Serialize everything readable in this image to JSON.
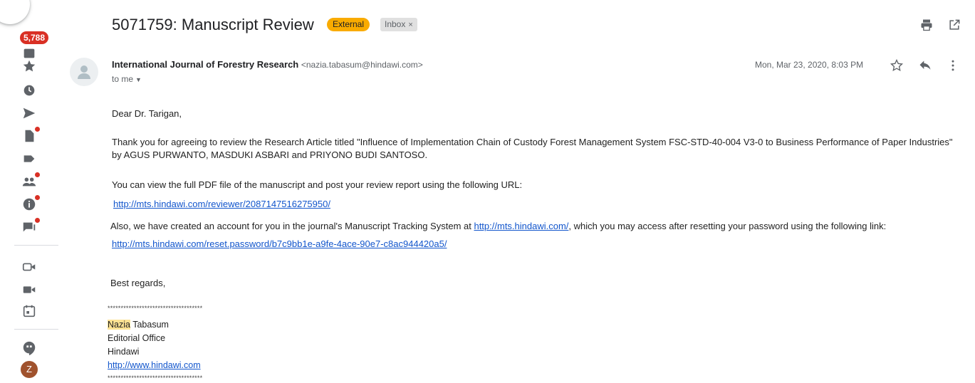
{
  "rail": {
    "unread_count": "5,788",
    "avatar_letter": "Z"
  },
  "email": {
    "subject": "5071759: Manuscript Review",
    "label_external": "External",
    "label_inbox": "Inbox",
    "label_inbox_close": "×",
    "sender_name": "International Journal of Forestry Research",
    "sender_email": "<nazia.tabasum@hindawi.com>",
    "to": "to me",
    "date": "Mon, Mar 23, 2020, 8:03 PM"
  },
  "body": {
    "greeting": "Dear Dr. Tarigan,",
    "para1": "Thank you for agreeing to review the Research Article titled \"Influence of Implementation Chain of Custody Forest Management System FSC-STD-40-004 V3-0 to Business Performance of Paper Industries\" by AGUS PURWANTO, MASDUKI ASBARI and PRIYONO BUDI SANTOSO.",
    "para2": "You can view the full PDF file of the manuscript and post your review report using the following URL:",
    "link1": "http://mts.hindawi.com/reviewer/2087147516275950/",
    "para3_prefix": "Also, we have created an account for you in the journal's Manuscript Tracking System at ",
    "para3_link": "http://mts.hindawi.com/",
    "para3_suffix": ", which you may access after resetting your password using the following link:",
    "link2": "http://mts.hindawi.com/reset.password/b7c9bb1e-a9fe-4ace-90e7-c8ac944420a5/",
    "closing": "Best regards,"
  },
  "signature": {
    "stars": "************************************",
    "first_name": "Nazia",
    "last_name": " Tabasum",
    "office": "Editorial Office",
    "company": "Hindawi",
    "website": "http://www.hindawi.com"
  },
  "colors": {
    "badge_red": "#d93025",
    "external_chip": "#f9ab00",
    "link_blue": "#1155cc",
    "highlight": "#fde293"
  }
}
